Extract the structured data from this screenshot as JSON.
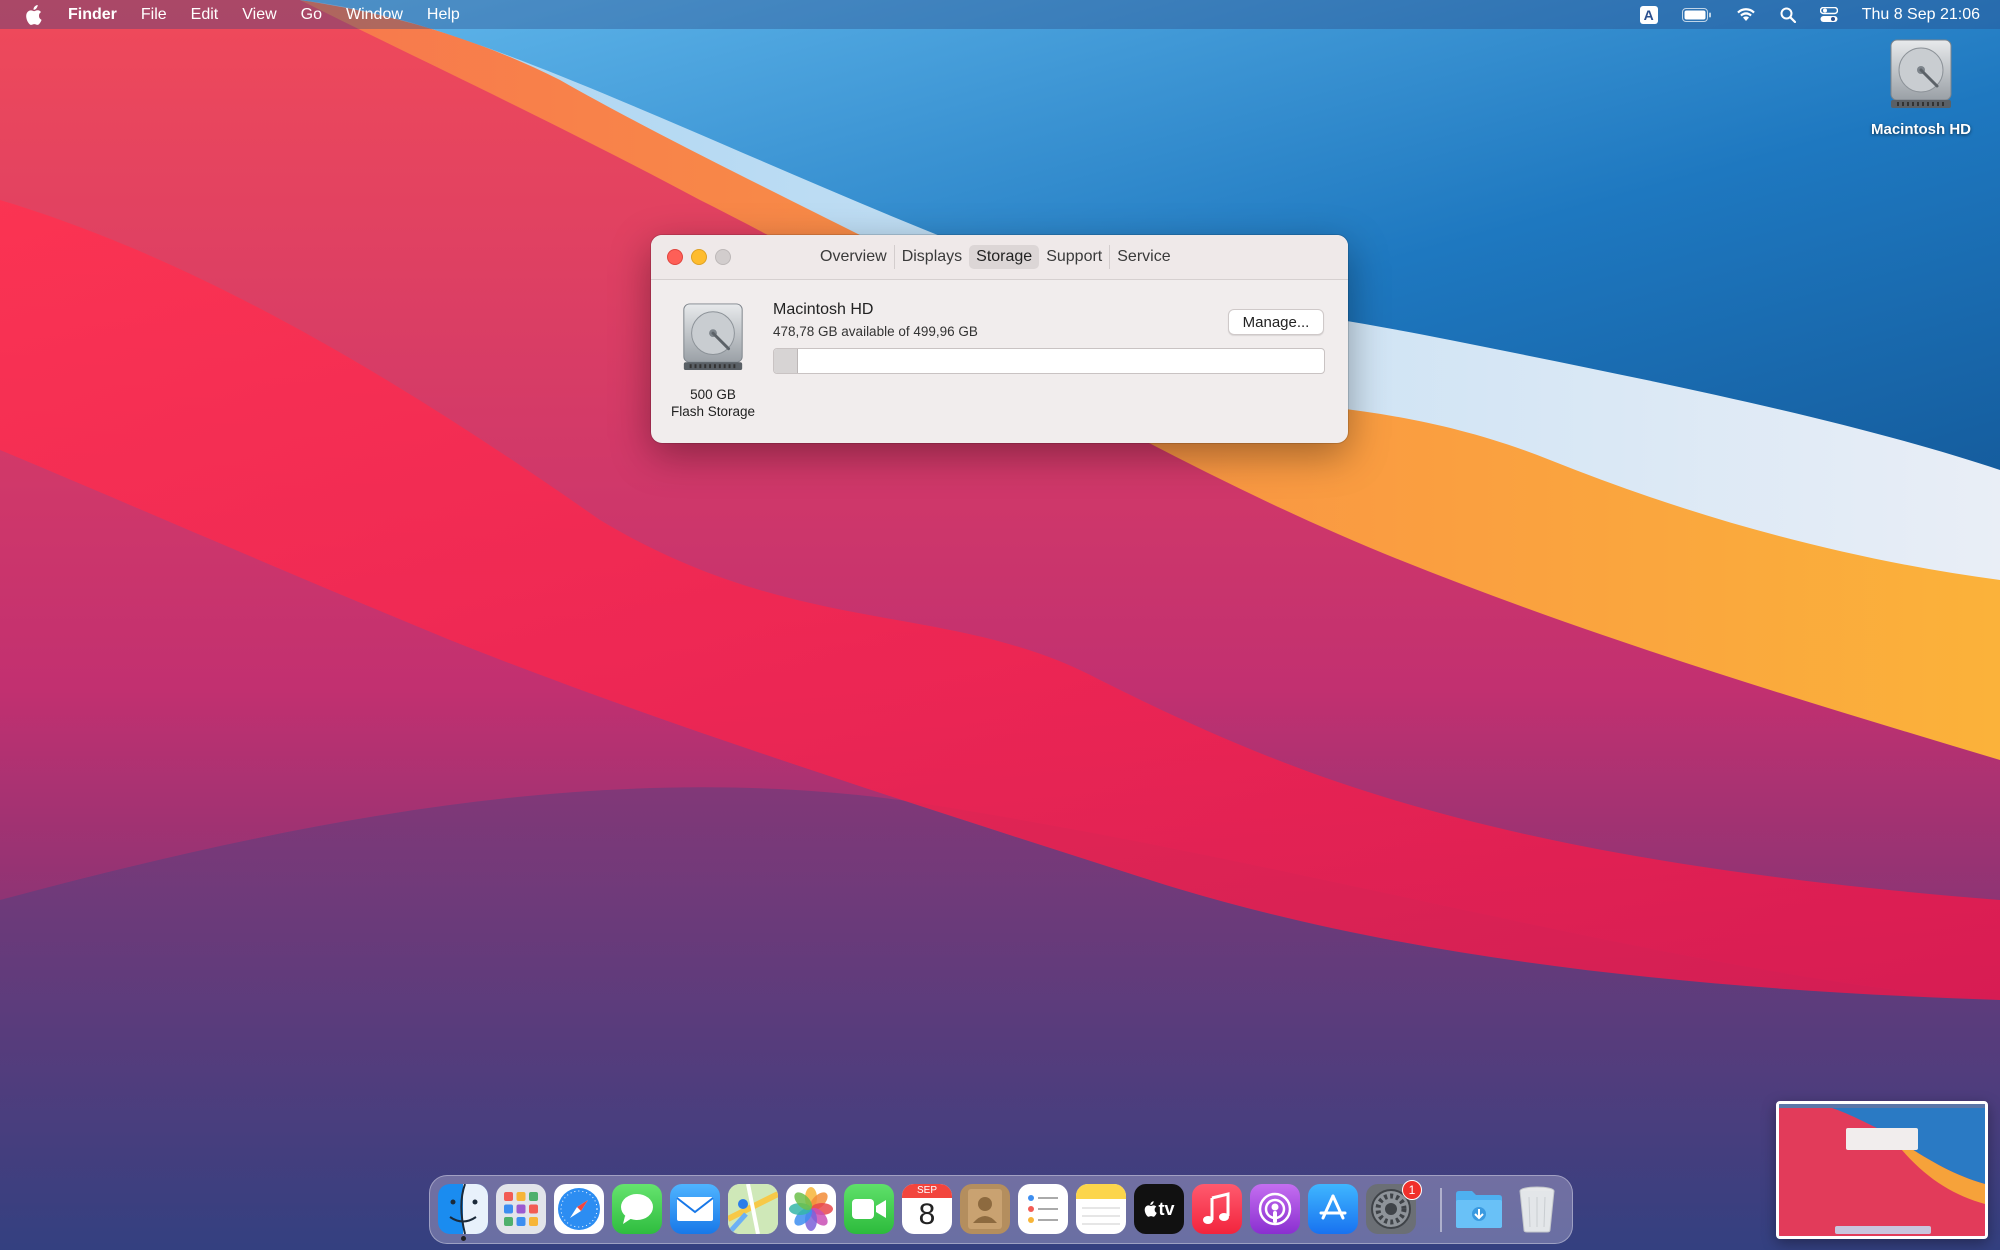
{
  "menubar": {
    "app_name": "Finder",
    "items": [
      "File",
      "Edit",
      "View",
      "Go",
      "Window",
      "Help"
    ],
    "input_source": "A",
    "clock": "Thu 8 Sep  21:06",
    "status_icons": [
      "input-source-icon",
      "battery-icon",
      "wifi-icon",
      "spotlight-search-icon",
      "control-center-icon"
    ]
  },
  "desktop": {
    "icons": [
      {
        "label": "Macintosh HD",
        "icon": "hard-drive-icon"
      }
    ]
  },
  "window": {
    "tabs": [
      "Overview",
      "Displays",
      "Storage",
      "Support",
      "Service"
    ],
    "active_tab": "Storage",
    "drive_capacity": "500 GB",
    "drive_type": "Flash Storage",
    "volume_name": "Macintosh HD",
    "availability": "478,78 GB available of 499,96 GB",
    "used_fraction": 0.042,
    "manage_label": "Manage..."
  },
  "dock": {
    "apps": [
      "Finder",
      "Launchpad",
      "Safari",
      "Messages",
      "Mail",
      "Maps",
      "Photos",
      "FaceTime",
      "Calendar",
      "Contacts",
      "Reminders",
      "Notes",
      "TV",
      "Music",
      "Podcasts",
      "App Store",
      "System Preferences"
    ],
    "calendar_month": "SEP",
    "calendar_day": "8",
    "tv_label": "tv",
    "system_preferences_badge": "1",
    "folders": [
      "Downloads",
      "Trash"
    ]
  },
  "colors": {
    "close": "#fe5f57",
    "minimize": "#febc2e",
    "zoom_inactive": "#d2cdcd",
    "badge": "#f0302b"
  }
}
